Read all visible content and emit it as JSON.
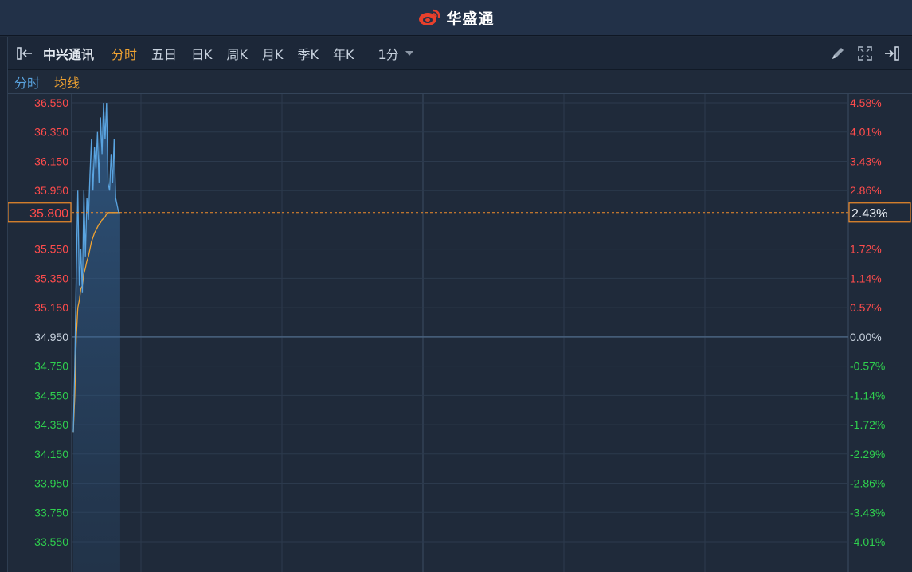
{
  "header": {
    "brand_name": "华盛通",
    "brand_color": "#e8402c"
  },
  "toolbar": {
    "stock_name": "中兴通讯",
    "tabs": [
      {
        "label": "分时",
        "active": true
      },
      {
        "label": "五日",
        "active": false
      },
      {
        "label": "日K",
        "active": false
      },
      {
        "label": "周K",
        "active": false
      },
      {
        "label": "月K",
        "active": false
      },
      {
        "label": "季K",
        "active": false
      },
      {
        "label": "年K",
        "active": false
      }
    ],
    "period_label": "1分",
    "tool_icons": [
      "pencil-icon",
      "fullscreen-icon",
      "collapse-panel-icon"
    ]
  },
  "legend": {
    "intraday_label": "分时",
    "average_label": "均线",
    "intraday_color": "#5aa4e0",
    "average_color": "#f0a332"
  },
  "chart_data": {
    "type": "line",
    "prev_close": 34.95,
    "current_price": "35.800",
    "current_change": "2.43%",
    "ylim": [
      33.55,
      36.55
    ],
    "price_ticks": [
      "36.550",
      "36.350",
      "36.150",
      "35.950",
      "35.550",
      "35.350",
      "35.150",
      "34.950",
      "34.750",
      "34.550",
      "34.350",
      "34.150",
      "33.950",
      "33.750",
      "33.550"
    ],
    "pct_ticks": [
      "4.58%",
      "4.01%",
      "3.43%",
      "2.86%",
      "1.72%",
      "1.14%",
      "0.57%",
      "0.00%",
      "-0.57%",
      "-1.14%",
      "-1.72%",
      "-2.29%",
      "-2.86%",
      "-3.43%",
      "-4.01%"
    ],
    "series": [
      {
        "name": "分时",
        "x": [
          0,
          1,
          2,
          3,
          4,
          5,
          6,
          7,
          8,
          9,
          10,
          11,
          12,
          13,
          14,
          15,
          16,
          17,
          18,
          19,
          20,
          21,
          22,
          23,
          24,
          25,
          26,
          27,
          28,
          29,
          30,
          31
        ],
        "values": [
          34.3,
          34.75,
          35.4,
          35.95,
          35.3,
          35.55,
          35.25,
          35.95,
          35.5,
          35.9,
          35.75,
          36.05,
          36.3,
          35.95,
          36.25,
          36.1,
          36.35,
          36.0,
          36.45,
          36.2,
          36.55,
          36.3,
          36.55,
          36.0,
          35.95,
          36.2,
          36.0,
          36.3,
          35.9,
          35.85,
          35.8,
          35.8
        ]
      },
      {
        "name": "均线",
        "x": [
          0,
          1,
          2,
          3,
          4,
          5,
          6,
          7,
          8,
          9,
          10,
          11,
          12,
          13,
          14,
          15,
          16,
          17,
          18,
          19,
          20,
          21,
          22,
          23,
          24,
          25,
          26,
          27,
          28,
          29,
          30,
          31
        ],
        "values": [
          34.3,
          34.55,
          34.95,
          35.15,
          35.2,
          35.28,
          35.3,
          35.38,
          35.42,
          35.47,
          35.5,
          35.55,
          35.6,
          35.63,
          35.66,
          35.68,
          35.7,
          35.72,
          35.73,
          35.75,
          35.76,
          35.77,
          35.79,
          35.8,
          35.8,
          35.8,
          35.8,
          35.8,
          35.8,
          35.8,
          35.8,
          35.8
        ]
      }
    ],
    "colors": {
      "up": "#ff4c4c",
      "down": "#2fcf4e",
      "flat": "#c9d3df",
      "price_line": "#5aa4e0",
      "avg_line": "#f0a332",
      "crosshair": "#f08c2a"
    }
  }
}
